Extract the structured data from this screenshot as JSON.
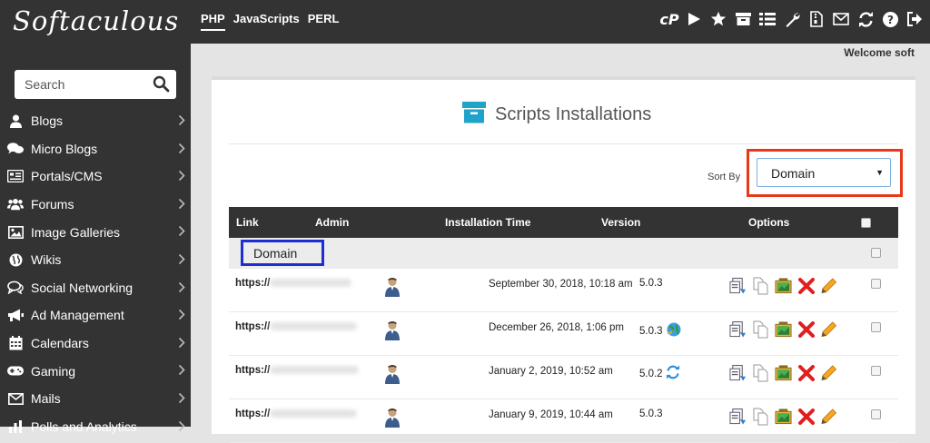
{
  "app": {
    "logo": "Softaculous",
    "welcome": "Welcome soft"
  },
  "topnav": {
    "langs": [
      {
        "label": "PHP",
        "active": true
      },
      {
        "label": "JavaScripts",
        "active": false
      },
      {
        "label": "PERL",
        "active": false
      }
    ],
    "icons": [
      "cpanel-icon",
      "play-icon",
      "star-icon",
      "archive-icon",
      "list-icon",
      "wrench-icon",
      "file-zip-icon",
      "envelope-icon",
      "refresh-icon",
      "help-icon",
      "logout-icon"
    ],
    "cpanel_text": "cP"
  },
  "sidebar": {
    "search_label": "Search",
    "items": [
      {
        "label": "Blogs",
        "icon": "user-icon"
      },
      {
        "label": "Micro Blogs",
        "icon": "comments-icon"
      },
      {
        "label": "Portals/CMS",
        "icon": "newspaper-icon"
      },
      {
        "label": "Forums",
        "icon": "users-icon"
      },
      {
        "label": "Image Galleries",
        "icon": "image-icon"
      },
      {
        "label": "Wikis",
        "icon": "globe-icon"
      },
      {
        "label": "Social Networking",
        "icon": "chat-icon"
      },
      {
        "label": "Ad Management",
        "icon": "megaphone-icon"
      },
      {
        "label": "Calendars",
        "icon": "calendar-icon"
      },
      {
        "label": "Gaming",
        "icon": "gamepad-icon"
      },
      {
        "label": "Mails",
        "icon": "envelope-icon"
      },
      {
        "label": "Polls and Analytics",
        "icon": "chart-icon"
      }
    ]
  },
  "panel": {
    "title": "Scripts Installations",
    "sort_label": "Sort By",
    "sort_value": "Domain",
    "columns": [
      "Link",
      "Admin",
      "Installation Time",
      "Version",
      "Options"
    ],
    "group_label": "Domain",
    "rows": [
      {
        "link": "https://",
        "time": "September 30, 2018, 10:18 am",
        "version": "5.0.3",
        "ver_icon": ""
      },
      {
        "link": "https://",
        "time": "December 26, 2018, 1:06 pm",
        "version": "5.0.3",
        "ver_icon": "upgrade-globe-icon"
      },
      {
        "link": "https://",
        "time": "January 2, 2019, 10:52 am",
        "version": "5.0.2",
        "ver_icon": "sync-icon"
      },
      {
        "link": "https://",
        "time": "January 9, 2019, 10:44 am",
        "version": "5.0.3",
        "ver_icon": ""
      }
    ]
  },
  "colors": {
    "dark": "#333333",
    "highlight_red": "#e8381a",
    "highlight_blue": "#1d2fd1",
    "accent": "#1fa3c8"
  }
}
